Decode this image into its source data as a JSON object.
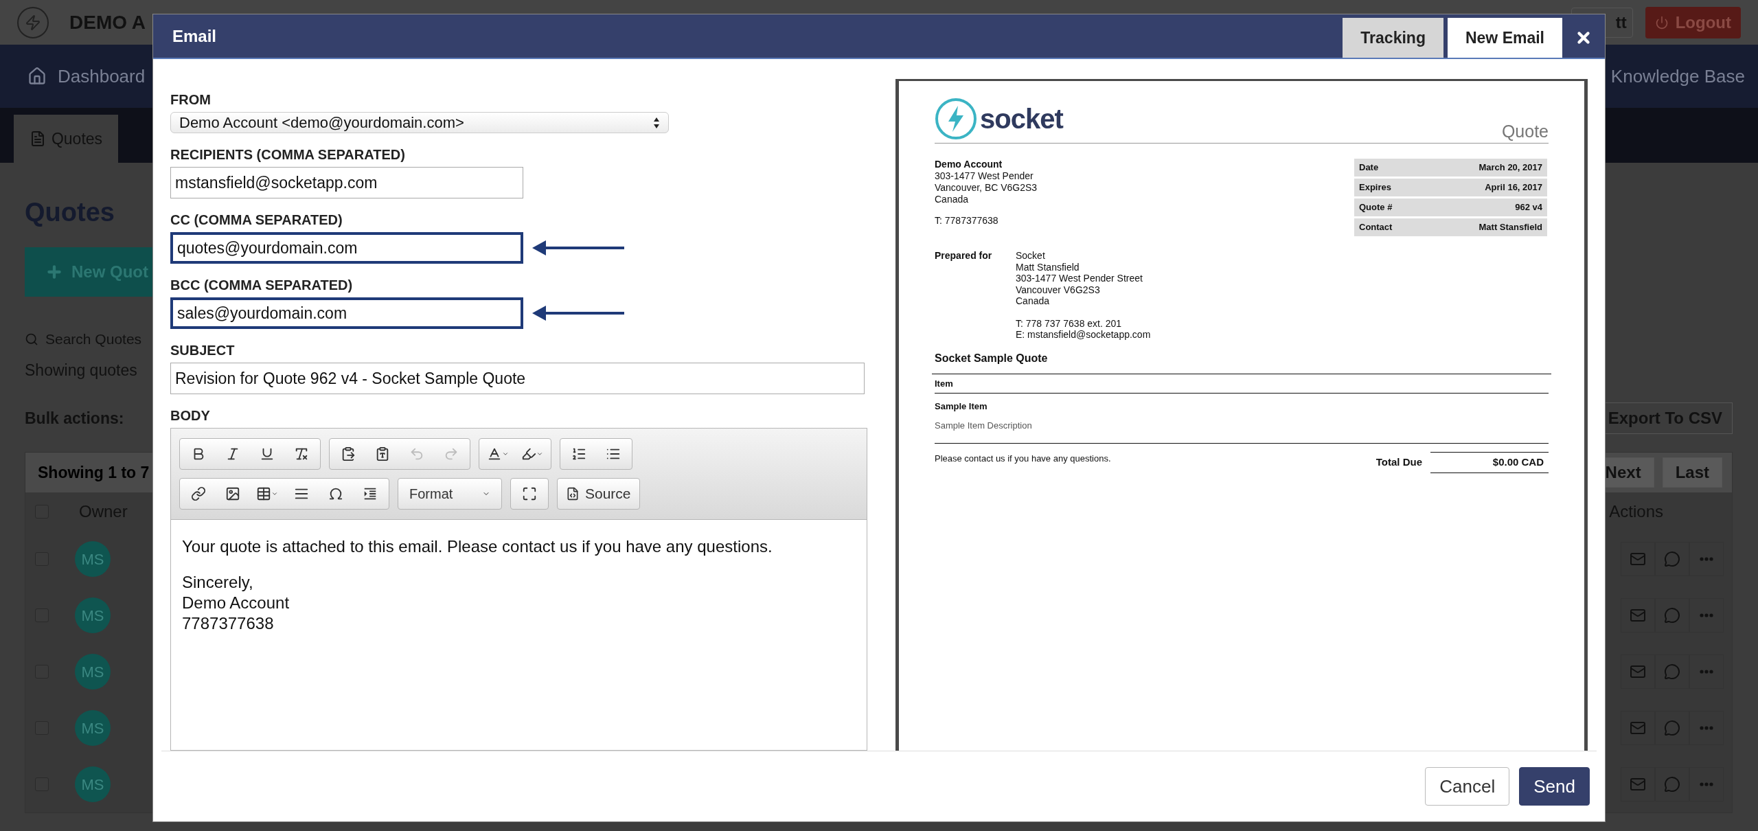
{
  "background": {
    "app_bar": {
      "brand": "DEMO A",
      "account_button": "tt",
      "logout_button": "Logout"
    },
    "nav": {
      "left": "Dashboard",
      "right": "Knowledge Base"
    },
    "subnav_tabs": [
      {
        "label": "Quotes",
        "selected": true
      }
    ],
    "page": {
      "title": "Quotes",
      "new_button": "New Quot",
      "search": "Search Quotes",
      "showing": "Showing quotes",
      "bulk_label": "Bulk actions:",
      "export_button": "Export To CSV"
    },
    "table": {
      "summary": "Showing 1 to 7",
      "pager": [
        "Next",
        "Last"
      ],
      "columns": [
        "Owner",
        "Actions"
      ],
      "header_checked": false,
      "rows": [
        {
          "owner": "MS",
          "checked": false
        },
        {
          "owner": "MS",
          "checked": false
        },
        {
          "owner": "MS",
          "checked": false
        },
        {
          "owner": "MS",
          "checked": false
        },
        {
          "owner": "MS",
          "checked": false
        }
      ]
    }
  },
  "modal": {
    "title": "Email",
    "tabs": [
      {
        "label": "Tracking",
        "selected": false
      },
      {
        "label": "New Email",
        "selected": true
      }
    ],
    "fields": [
      {
        "label": "FROM",
        "kind": "select",
        "value": "Demo Account <demo@yourdomain.com>",
        "highlighted": false
      },
      {
        "label": "RECIPIENTS (COMMA SEPARATED)",
        "kind": "short",
        "value": "mstansfield@socketapp.com",
        "highlighted": false
      },
      {
        "label": "CC (COMMA SEPARATED)",
        "kind": "short",
        "value": "quotes@yourdomain.com",
        "highlighted": true
      },
      {
        "label": "BCC (COMMA SEPARATED)",
        "kind": "short",
        "value": "sales@yourdomain.com",
        "highlighted": true
      },
      {
        "label": "SUBJECT",
        "kind": "long",
        "value": "Revision for Quote 962 v4 - Socket Sample Quote",
        "highlighted": false
      }
    ],
    "body_label": "BODY",
    "toolbar": [
      [
        [
          {
            "kind": "bold",
            "disabled": false
          },
          {
            "kind": "italic",
            "disabled": false
          },
          {
            "kind": "underline",
            "disabled": false
          },
          {
            "kind": "clear_format",
            "disabled": false
          }
        ],
        [
          {
            "kind": "paste_word",
            "disabled": false
          },
          {
            "kind": "paste_text",
            "disabled": false
          },
          {
            "kind": "undo",
            "disabled": true
          },
          {
            "kind": "redo",
            "disabled": true
          }
        ],
        [
          {
            "kind": "text_color",
            "disabled": false
          },
          {
            "kind": "bg_color",
            "disabled": false
          }
        ],
        [
          {
            "kind": "numbered_list",
            "disabled": false
          },
          {
            "kind": "bulleted_list",
            "disabled": false
          }
        ]
      ],
      [
        [
          {
            "kind": "link",
            "disabled": false
          },
          {
            "kind": "image",
            "disabled": false
          },
          {
            "kind": "table",
            "disabled": false
          },
          {
            "kind": "rule",
            "disabled": false
          },
          {
            "kind": "special_char",
            "disabled": false
          },
          {
            "kind": "blockquote",
            "disabled": false
          }
        ],
        [
          {
            "kind": "format",
            "label": "Format"
          }
        ],
        [
          {
            "kind": "maximize",
            "disabled": false
          }
        ],
        [
          {
            "kind": "source",
            "label": "Source"
          }
        ]
      ]
    ],
    "body": [
      [
        "Your quote is attached to this email. Please contact us if you have any questions."
      ],
      [
        "Sincerely,",
        "Demo Account",
        "7787377638"
      ]
    ],
    "preview": {
      "logo": "socket",
      "doc_title": "Quote",
      "from": {
        "name": "Demo Account",
        "lines": [
          "303-1477 West Pender",
          "Vancouver, BC V6G2S3",
          "Canada"
        ],
        "phone": "T: 7787377638"
      },
      "meta": [
        {
          "label": "Date",
          "value": "March 20, 2017"
        },
        {
          "label": "Expires",
          "value": "April 16, 2017"
        },
        {
          "label": "Quote #",
          "value": "962 v4"
        },
        {
          "label": "Contact",
          "value": "Matt Stansfield"
        }
      ],
      "prepared_label": "Prepared for",
      "prepared_lines": [
        "Socket",
        "Matt Stansfield",
        "303-1477 West Pender Street",
        "Vancouver V6G2S3",
        "Canada"
      ],
      "prepared_contact": [
        "T: 778 737 7638 ext. 201",
        "E: mstansfield@socketapp.com"
      ],
      "quote_name": "Socket Sample Quote",
      "item_header": "Item",
      "items": [
        {
          "name": "Sample Item",
          "description": "Sample Item Description"
        }
      ],
      "note": "Please contact us if you have any questions.",
      "total_label": "Total Due",
      "total_value": "$0.00 CAD"
    },
    "buttons": [
      {
        "label": "Cancel",
        "kind": "secondary"
      },
      {
        "label": "Send",
        "kind": "primary"
      }
    ]
  }
}
